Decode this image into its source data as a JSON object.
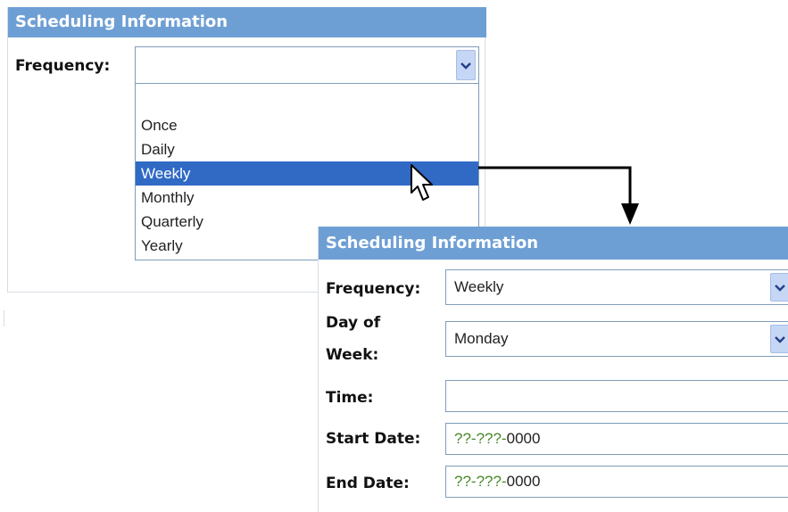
{
  "panel1": {
    "header": "Scheduling Information",
    "frequency_label": "Frequency:",
    "frequency_value": "",
    "options": [
      "",
      "Once",
      "Daily",
      "Weekly",
      "Monthly",
      "Quarterly",
      "Yearly"
    ],
    "selected_option": "Weekly"
  },
  "panel2": {
    "header": "Scheduling Information",
    "frequency_label": "Frequency:",
    "frequency_value": "Weekly",
    "day_of_week_label_line1": "Day of",
    "day_of_week_label_line2": "Week:",
    "day_of_week_value": "Monday",
    "time_label": "Time:",
    "time_value": "",
    "start_date_label": "Start Date:",
    "start_date_prefix": "??-???-",
    "start_date_year": "0000",
    "end_date_label": "End Date:",
    "end_date_prefix": "??-???-",
    "end_date_year": "0000"
  },
  "icons": {
    "dropdown": "chevron-down-icon",
    "cursor": "mouse-pointer-icon",
    "connector": "arrow-connector-icon"
  },
  "colors": {
    "header_bg": "#6e9fd4",
    "selection_bg": "#316ac5",
    "field_border": "#7f9db9",
    "dropdown_button": "#c6d7f5",
    "placeholder_text": "#4a8a2a"
  }
}
